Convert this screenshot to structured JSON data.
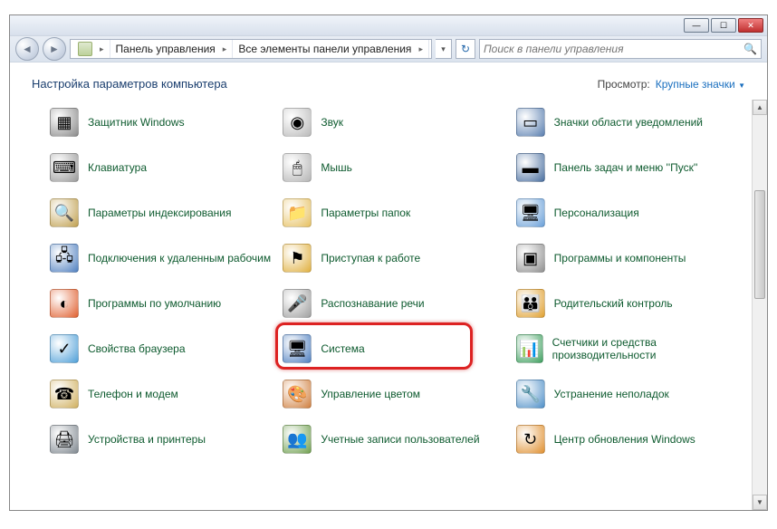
{
  "titlebar": {
    "minimize": "—",
    "maximize": "☐",
    "close": "✕"
  },
  "breadcrumbs": {
    "items": [
      "Панель управления",
      "Все элементы панели управления"
    ]
  },
  "search": {
    "placeholder": "Поиск в панели управления"
  },
  "header": {
    "title": "Настройка параметров компьютера",
    "view_label": "Просмотр:",
    "view_value": "Крупные значки"
  },
  "items": [
    {
      "label": "Защитник Windows",
      "icon": "shield",
      "name": "item-windows-defender"
    },
    {
      "label": "Звук",
      "icon": "speaker",
      "name": "item-sound"
    },
    {
      "label": "Значки области уведомлений",
      "icon": "tray",
      "name": "item-notification-icons"
    },
    {
      "label": "Клавиатура",
      "icon": "keyboard",
      "name": "item-keyboard"
    },
    {
      "label": "Мышь",
      "icon": "mouse",
      "name": "item-mouse"
    },
    {
      "label": "Панель задач и меню ''Пуск''",
      "icon": "taskbar",
      "name": "item-taskbar"
    },
    {
      "label": "Параметры индексирования",
      "icon": "index",
      "name": "item-indexing"
    },
    {
      "label": "Параметры папок",
      "icon": "folder",
      "name": "item-folder-options"
    },
    {
      "label": "Персонализация",
      "icon": "personalize",
      "name": "item-personalization"
    },
    {
      "label": "Подключения к удаленным рабочим",
      "icon": "remote",
      "name": "item-remote"
    },
    {
      "label": "Приступая к работе",
      "icon": "flag",
      "name": "item-getting-started"
    },
    {
      "label": "Программы и компоненты",
      "icon": "programs",
      "name": "item-programs"
    },
    {
      "label": "Программы по умолчанию",
      "icon": "default",
      "name": "item-default-programs"
    },
    {
      "label": "Распознавание речи",
      "icon": "mic",
      "name": "item-speech"
    },
    {
      "label": "Родительский контроль",
      "icon": "parental",
      "name": "item-parental"
    },
    {
      "label": "Свойства браузера",
      "icon": "browser",
      "name": "item-internet-options"
    },
    {
      "label": "Система",
      "icon": "system",
      "name": "item-system"
    },
    {
      "label": "Счетчики и средства производительности",
      "icon": "perf",
      "name": "item-performance"
    },
    {
      "label": "Телефон и модем",
      "icon": "phone",
      "name": "item-phone-modem"
    },
    {
      "label": "Управление цветом",
      "icon": "color",
      "name": "item-color-management"
    },
    {
      "label": "Устранение неполадок",
      "icon": "troubleshoot",
      "name": "item-troubleshooting"
    },
    {
      "label": "Устройства и принтеры",
      "icon": "devices",
      "name": "item-devices-printers"
    },
    {
      "label": "Учетные записи пользователей",
      "icon": "users",
      "name": "item-user-accounts"
    },
    {
      "label": "Центр обновления Windows",
      "icon": "update",
      "name": "item-windows-update"
    }
  ],
  "highlight": {
    "target": "item-system"
  },
  "icon_colors": {
    "shield": "#8a8a8a",
    "speaker": "#bababa",
    "tray": "#5a7fb0",
    "keyboard": "#9a9a9a",
    "mouse": "#b5b5b5",
    "taskbar": "#4a6fa0",
    "index": "#c0a050",
    "folder": "#e6c060",
    "personalize": "#6aa0d8",
    "remote": "#5080c0",
    "flag": "#e0b040",
    "programs": "#909090",
    "default": "#e06030",
    "mic": "#a0a0a0",
    "parental": "#e0a030",
    "browser": "#50a0d8",
    "system": "#5080c0",
    "perf": "#40a060",
    "phone": "#d0b060",
    "color": "#d08040",
    "troubleshoot": "#5090c8",
    "devices": "#808890",
    "users": "#70a050",
    "update": "#e09030"
  }
}
